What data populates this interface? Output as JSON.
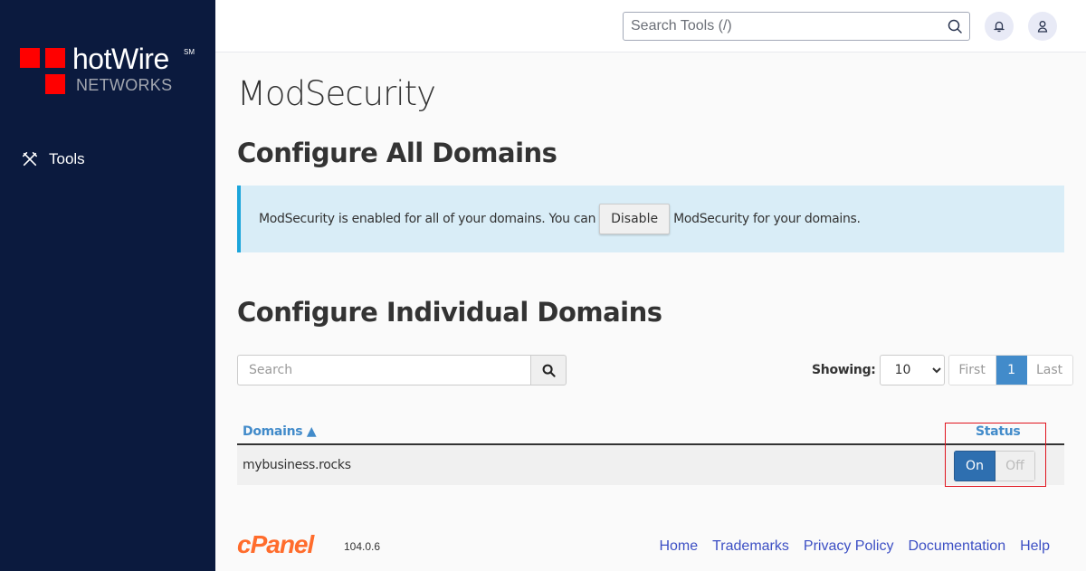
{
  "brand": {
    "name": "hotWire",
    "mark": "SM",
    "subtitle": "NETWORKS",
    "color": "#ff0000"
  },
  "sidebar": {
    "items": [
      {
        "label": "Tools",
        "icon": "tools-icon"
      }
    ]
  },
  "topbar": {
    "search_placeholder": "Search Tools (/)",
    "icons": [
      "search-icon",
      "bell-icon",
      "user-icon"
    ]
  },
  "page": {
    "title": "ModSecurity",
    "section_all": "Configure All Domains",
    "alert": {
      "text_before": "ModSecurity is enabled for all of your domains. You can",
      "button": "Disable",
      "text_after": "ModSecurity for your domains."
    },
    "section_individual": "Configure Individual Domains",
    "search_placeholder": "Search",
    "showing_label": "Showing:",
    "page_size": "10",
    "pager": {
      "first": "First",
      "current": "1",
      "last": "Last"
    },
    "table": {
      "columns": [
        "Domains ▲",
        "Status"
      ],
      "rows": [
        {
          "domain": "mybusiness.rocks",
          "on_label": "On",
          "off_label": "Off",
          "status": "On"
        }
      ]
    }
  },
  "footer": {
    "logo": "cPanel",
    "version": "104.0.6",
    "links": [
      "Home",
      "Trademarks",
      "Privacy Policy",
      "Documentation",
      "Help"
    ]
  },
  "colors": {
    "sidebar_bg": "#0b1a3e",
    "accent": "#428bca",
    "toggle_on": "#2e6fb0",
    "alert_bg": "#d9edf7",
    "highlight": "#e0141e",
    "cpanel_orange": "#ff6c2c"
  }
}
